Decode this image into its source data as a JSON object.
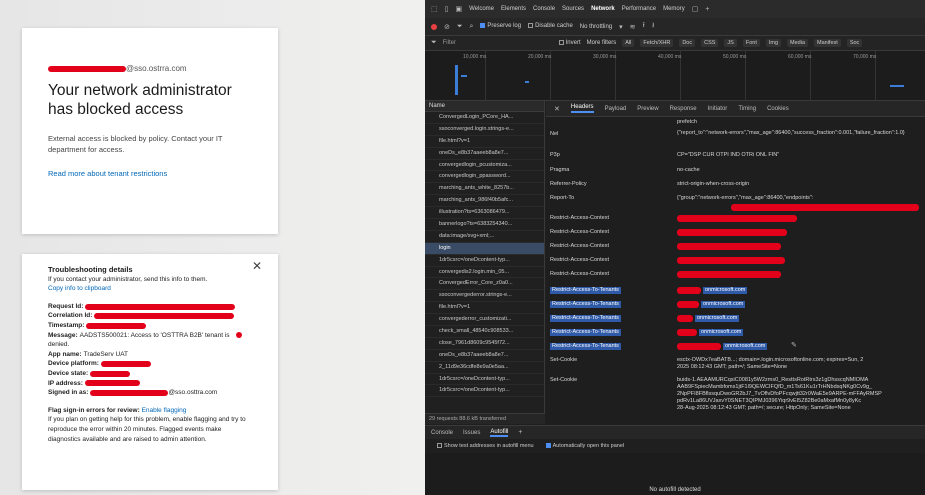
{
  "login": {
    "email_domain": "@sso.ostrra.com",
    "title": "Your network administrator has blocked access",
    "body": "External access is blocked by policy. Contact your IT department for access.",
    "link": "Read more about tenant restrictions"
  },
  "troubleshoot": {
    "title": "Troubleshooting details",
    "intro": "If you contact your administrator, send this info to them.",
    "copy_link": "Copy info to clipboard",
    "labels": {
      "request_id": "Request Id:",
      "correlation_id": "Correlation Id:",
      "timestamp": "Timestamp:",
      "message": "Message:",
      "app_name": "App name:",
      "device_platform": "Device platform:",
      "device_state": "Device state:",
      "ip_address": "IP address:",
      "signed_in_as": "Signed in as:"
    },
    "message_text": "AADSTS500021: Access to 'OSTTRA B2B' tenant is",
    "message_text2": "denied.",
    "app_name": "TradeServ UAT",
    "signed_in_domain": "@sso.osttra.com",
    "flag_title": "Flag sign-in errors for review:",
    "flag_link": "Enable flagging",
    "flag_body": "If you plan on getting help for this problem, enable flagging and try to reproduce the error within 20 minutes. Flagged events make diagnostics available and are raised to admin attention."
  },
  "devtools": {
    "tabs": [
      "Welcome",
      "Elements",
      "Console",
      "Sources",
      "Network",
      "Performance",
      "Memory"
    ],
    "active_tab": "Network",
    "netbar": {
      "preserve_log": "Preserve log",
      "disable_cache": "Disable cache",
      "throttle": "No throttling"
    },
    "filter": {
      "placeholder": "Filter",
      "invert": "Invert",
      "more_filters": "More filters",
      "chips": [
        "All",
        "Fetch/XHR",
        "Doc",
        "CSS",
        "JS",
        "Font",
        "Img",
        "Media",
        "Manifest",
        "Soc"
      ]
    },
    "ticks": [
      "10,000 ms",
      "20,000 ms",
      "30,000 ms",
      "40,000 ms",
      "50,000 ms",
      "60,000 ms",
      "70,000 ms"
    ],
    "list_header": "Name",
    "requests": [
      "ConvergedLogin_PCore_HA...",
      "ssoconverged.login.strings-e...",
      "file.html?v=1",
      "oneDs_e8b37aaeeb8a8e7...",
      "convergedlogin_pcustomiza...",
      "convergedlogin_ppassword...",
      "marching_ants_white_8257b...",
      "marching_ants_986f40b5afc...",
      "illustration?ts=6363086479...",
      "bannerlogo?ts=6383254340...",
      "data:image/svg+xml;...",
      "login",
      "1dr5csrc=/oneDcontent-typ...",
      "convergedis2.login.min_05...",
      "ConvergedError_Core_z0a0...",
      "ssoconvergederror.strings-e...",
      "file.html?v=1",
      "convergederror_customizati...",
      "check_small_48540c908533...",
      "close_7961d8609c9545f72...",
      "oneDs_e8b37aaeeb8a8e7...",
      "2_11d9e36cdfe8e9a0e5aa...",
      "1dr5csrc=/oneDcontent-typ...",
      "1dr5csrc=/oneDcontent-typ..."
    ],
    "selected_request": "login",
    "list_footer": "29 requests  88.6 kB transferred",
    "detail_tabs": [
      "Headers",
      "Payload",
      "Preview",
      "Response",
      "Initiator",
      "Timing",
      "Cookies"
    ],
    "headers": {
      "top_value": "prefetch",
      "nel_label": "Nel",
      "nel_value": "{\"report_to\":\"network-errors\",\"max_age\":86400,\"success_fraction\":0.001,\"failure_fraction\":1.0}",
      "nel_value2": "CP=\"DSP CUR OTPI IND OTRi ONL FIN\"",
      "p3p_label": "P3p",
      "pragma_label": "Pragma",
      "pragma_value": "no-cache",
      "referrer_label": "Referrer-Policy",
      "referrer_value": "strict-origin-when-cross-origin",
      "report_to_label": "Report-To",
      "report_to_value": "{\"group\":\"network-errors\",\"max_age\":86400,\"endpoints\":",
      "rac_label": "Restrict-Access-Context",
      "rat_label": "Restrict-Access-To-Tenants",
      "tenant_domain": "onmicrosoft.com",
      "set_cookie_label": "Set-Cookie",
      "set_cookie_1": "esctx-OWDx7eaBATB...; domain=.login.microsoftonline.com; expires=Sun, 2",
      "set_cookie_1b": "2025 08:12:43 GMT; path=/; SameSite=None",
      "set_cookie_2": "buids-1.AEAAMURCqsiC0081y5W2zms0_ResttsRotRtrs3z1gDhsscqNMIOMA",
      "set_cookie_2b": "AAB9FSpiecMambfoms1jtF1l9QEWCIFQfD_m1Ts61Ku1rTrHNbdsqNKg0Cv9g_",
      "set_cookie_2c": "2NpPFI8FBflssquDwoGR2bJ7_TvOflvDfoPFcqwjtt32r0WaE5e9ARPE-mFFAyRMSP",
      "set_cookie_2d": "pdRv1La86UVJaxvY0SNET3QIPMJ0396Yiqr9vEI5Z82Be0aMxafMn0y8yKc",
      "set_cookie_2e": "28-Aug-2025 08:12:43 GMT; path=/; secure; HttpOnly; SameSite=None"
    },
    "drawer_tabs": [
      "Console",
      "Issues",
      "Autofill"
    ],
    "drawer_active": "Autofill",
    "drawer_opt1": "Show test addresses in autofill menu",
    "drawer_opt2": "Automatically open this panel",
    "drawer_empty": "No autofill detected"
  }
}
